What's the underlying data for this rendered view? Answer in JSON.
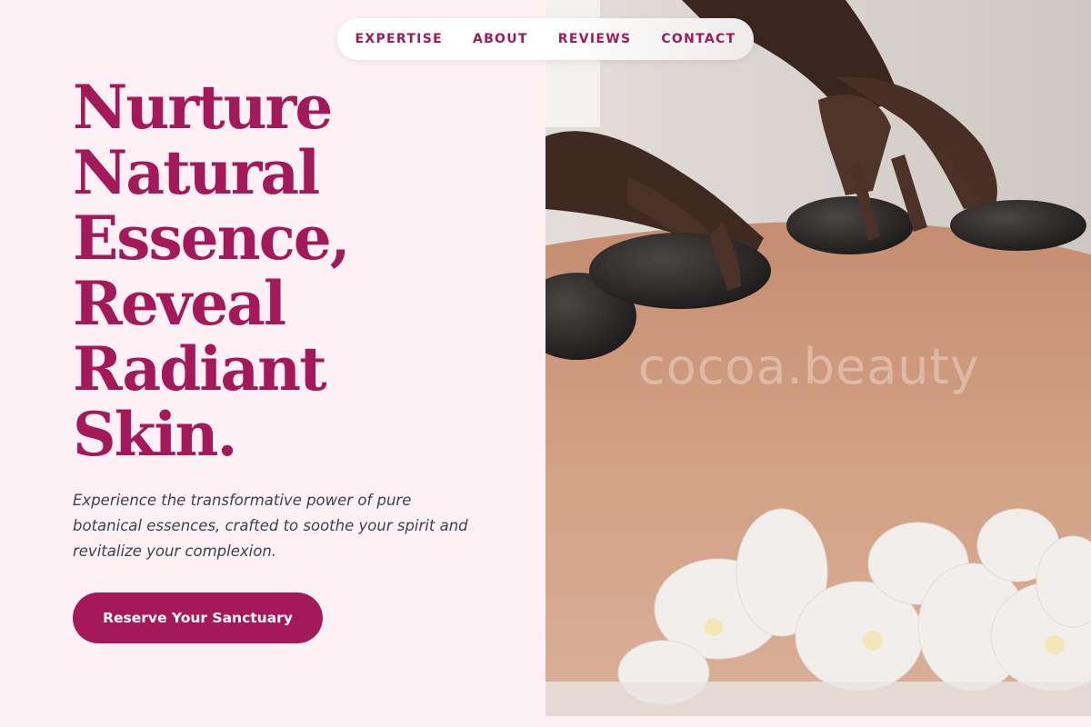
{
  "nav": {
    "items": [
      {
        "label": "EXPERTISE"
      },
      {
        "label": "ABOUT"
      },
      {
        "label": "REVIEWS"
      },
      {
        "label": "CONTACT"
      }
    ]
  },
  "hero": {
    "headline_lines": [
      "Nurture",
      "Natural",
      "Essence,",
      "Reveal",
      "Radiant",
      "Skin."
    ],
    "description": "Experience the transformative power of pure botanical essences, crafted to soothe your spirit and revitalize your complexion.",
    "cta_label": "Reserve Your Sanctuary"
  },
  "image": {
    "watermark": "cocoa.beauty",
    "subject": "hot stone massage with white orchids"
  },
  "colors": {
    "accent": "#a4195a",
    "background": "#fdf1f5",
    "body_text": "#3c4150"
  }
}
